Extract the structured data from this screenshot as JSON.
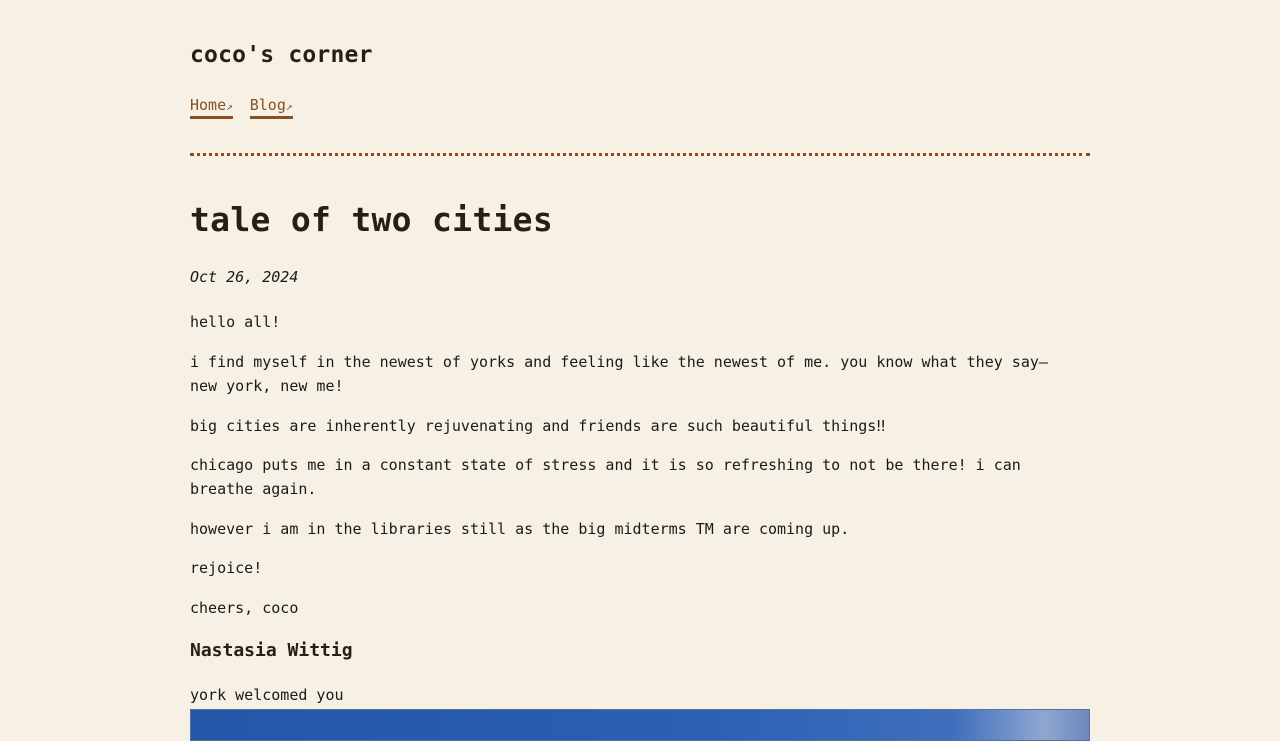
{
  "site": {
    "title": "coco's corner",
    "nav": [
      {
        "label": "Home",
        "arrow": "↗"
      },
      {
        "label": "Blog",
        "arrow": "↗"
      }
    ]
  },
  "post": {
    "title": "tale of two cities",
    "date": "Oct 26, 2024",
    "paragraphs": [
      "hello all!",
      "i find myself in the newest of yorks and feeling like the newest of me. you know what they say—new york, new me!",
      "big cities are inherently rejuvenating and friends are such beautiful things‼",
      "chicago puts me in a constant state of stress and it is so refreshing to not be there! i can breathe again.",
      "however i am in the libraries still as the big midterms TM are coming up.",
      "rejoice!",
      "cheers, coco"
    ]
  },
  "comment": {
    "author": "Nastasia Wittig",
    "text": "york welcomed you"
  },
  "colors": {
    "background": "#f7f0e4",
    "accent": "#8a4f22",
    "heading": "#2a1d12"
  }
}
